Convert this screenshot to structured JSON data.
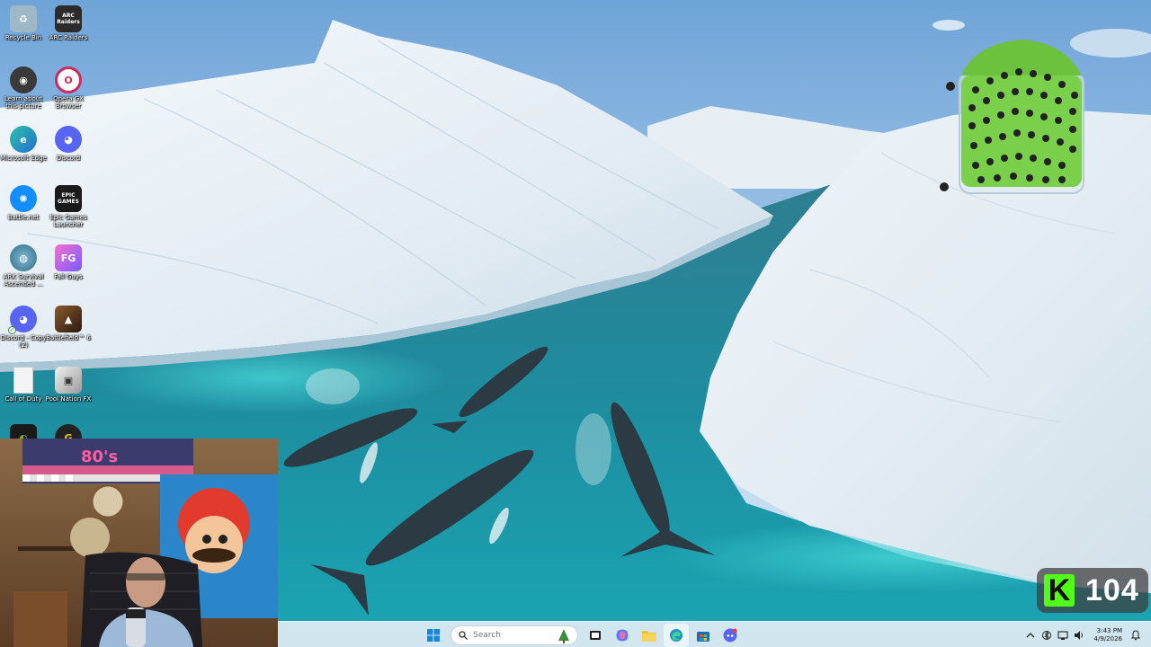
{
  "desktop": {
    "icons": [
      {
        "name": "desktop-icon-recycle-bin",
        "label": "Recycle Bin",
        "icon": "recycle-bin-icon",
        "color": "#9fb8c8"
      },
      {
        "name": "desktop-icon-arc-raiders",
        "label": "ARC Raiders",
        "icon": "arc-raiders-icon",
        "color": "#2b2b2b",
        "badge_text": "ARC Raiders"
      },
      {
        "name": "desktop-icon-learn-about-picture",
        "label": "Learn about this picture",
        "icon": "camera-icon",
        "color": "#3a3a3a"
      },
      {
        "name": "desktop-icon-opera-gx",
        "label": "Opera GX Browser",
        "icon": "opera-gx-icon",
        "color": "#cc2a5d"
      },
      {
        "name": "desktop-icon-microsoft-edge",
        "label": "Microsoft Edge",
        "icon": "edge-icon",
        "color": "#1f8fd6"
      },
      {
        "name": "desktop-icon-discord",
        "label": "Discord",
        "icon": "discord-icon",
        "color": "#5865f2"
      },
      {
        "name": "desktop-icon-battlenet",
        "label": "Battle.net",
        "icon": "battlenet-icon",
        "color": "#148eff"
      },
      {
        "name": "desktop-icon-epic-games",
        "label": "Epic Games Launcher",
        "icon": "epic-games-icon",
        "color": "#1a1a1a",
        "badge_text": "EPIC GAMES"
      },
      {
        "name": "desktop-icon-ark",
        "label": "ARK Survival Ascended ...",
        "icon": "ark-icon",
        "color": "#3c7a9a"
      },
      {
        "name": "desktop-icon-fall-guys",
        "label": "Fall Guys",
        "icon": "fall-guys-icon",
        "color": "#e04fb6"
      },
      {
        "name": "desktop-icon-discord-copy",
        "label": "Discord - Copy (2)",
        "icon": "discord-icon",
        "color": "#5865f2"
      },
      {
        "name": "desktop-icon-battlefield",
        "label": "Battlefield™ 6",
        "icon": "battlefield-icon",
        "color": "#5a3a22"
      },
      {
        "name": "desktop-icon-call-of-duty",
        "label": "Call of Duty",
        "icon": "file-icon",
        "color": "#f4f4f4"
      },
      {
        "name": "desktop-icon-pool-nation",
        "label": "Pool Nation FX",
        "icon": "cube-icon",
        "color": "#d8d8d8"
      },
      {
        "name": "desktop-icon-nvidia",
        "label": "",
        "icon": "nvidia-icon",
        "color": "#76b900"
      },
      {
        "name": "desktop-icon-geforce",
        "label": "",
        "icon": "geforce-icon",
        "color": "#222222"
      }
    ]
  },
  "webcam": {
    "sign_text": "80's"
  },
  "kick_badge": {
    "logo_letter": "K",
    "count": "104",
    "accent": "#53fc18"
  },
  "taskbar": {
    "search_placeholder": "Search",
    "apps": [
      {
        "name": "taskbar-start-button",
        "icon": "windows-start-icon"
      },
      {
        "name": "taskbar-task-view-button",
        "icon": "task-view-icon"
      },
      {
        "name": "taskbar-copilot-button",
        "icon": "copilot-icon"
      },
      {
        "name": "taskbar-file-explorer-button",
        "icon": "folder-icon"
      },
      {
        "name": "taskbar-edge-button",
        "icon": "edge-icon"
      },
      {
        "name": "taskbar-store-button",
        "icon": "store-icon"
      },
      {
        "name": "taskbar-discord-button",
        "icon": "discord-icon"
      }
    ],
    "tray": {
      "time": "3:43 PM",
      "date": "4/9/2026"
    }
  }
}
